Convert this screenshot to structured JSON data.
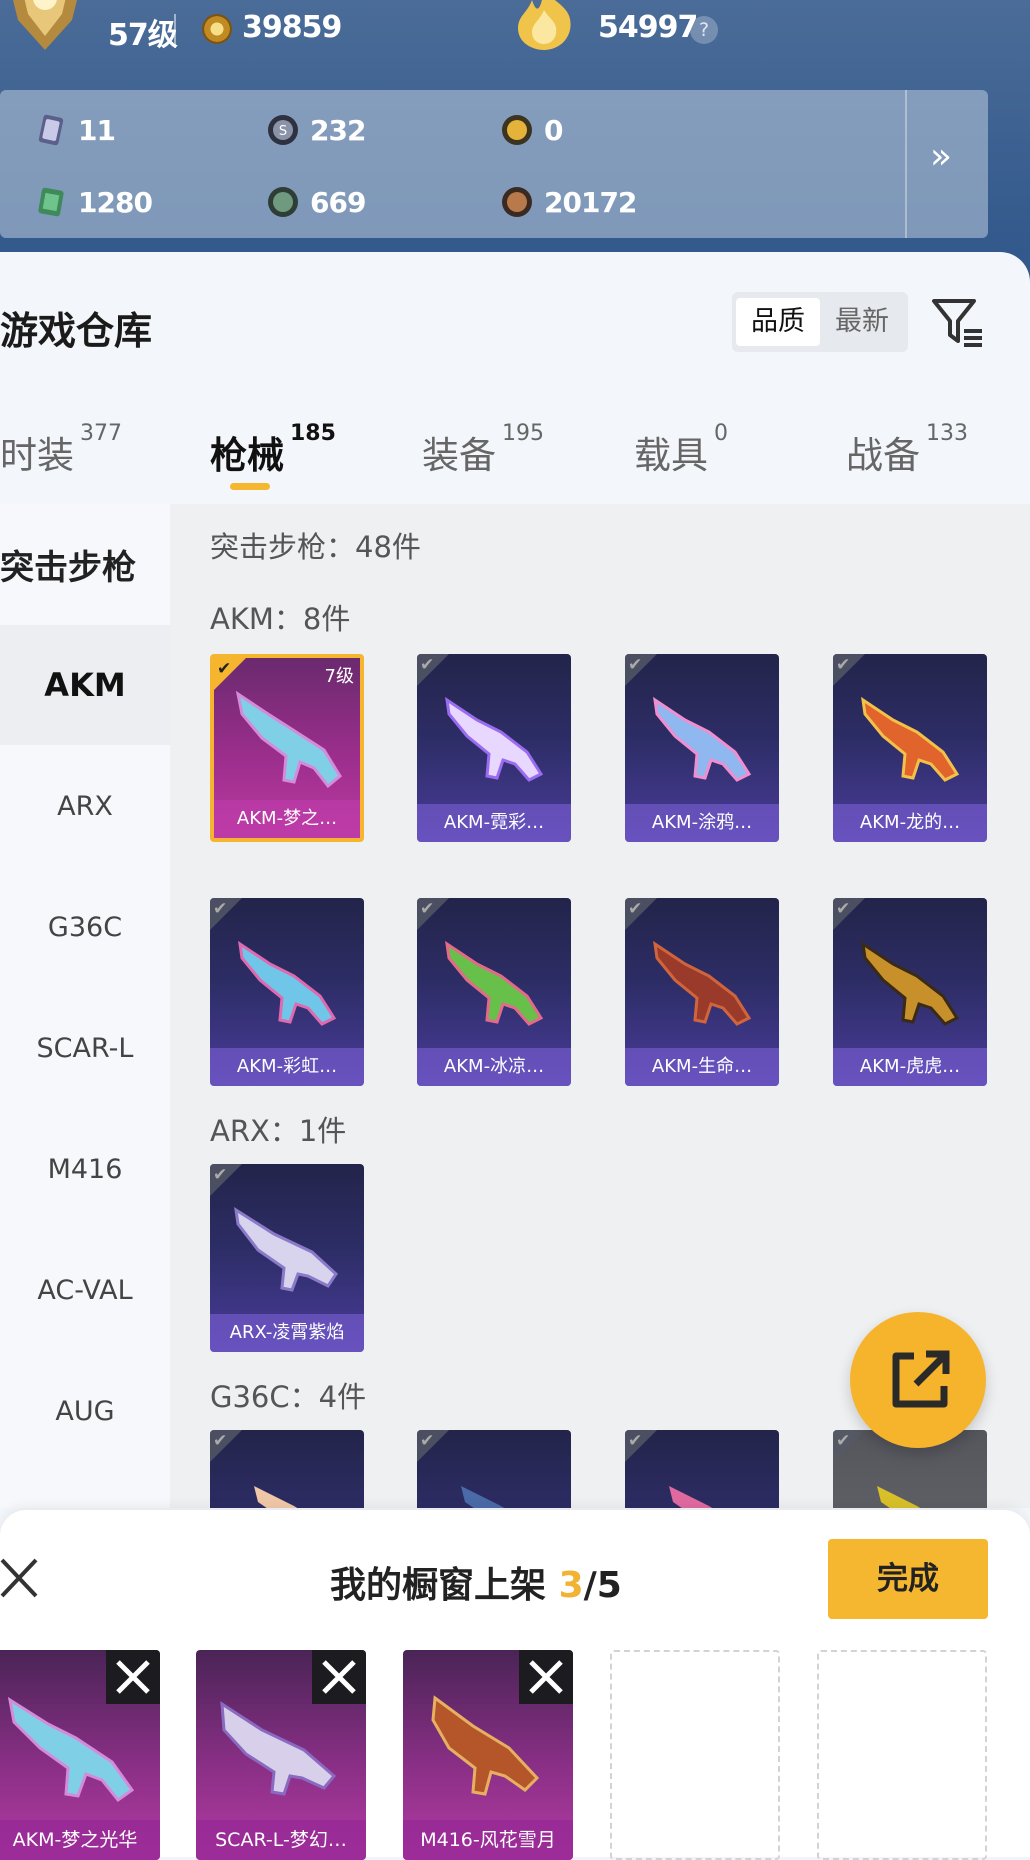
{
  "header": {
    "level": "57级",
    "coins": "39859",
    "heat": "54997",
    "help": "?"
  },
  "currencies": [
    {
      "icon": "card-icon",
      "value": "11"
    },
    {
      "icon": "silver-coin-icon",
      "value": "232"
    },
    {
      "icon": "gold-token-icon",
      "value": "0"
    },
    {
      "icon": "voucher-icon",
      "value": "1280"
    },
    {
      "icon": "green-orb-icon",
      "value": "669"
    },
    {
      "icon": "bronze-orb-icon",
      "value": "20172"
    }
  ],
  "warehouse": {
    "title": "游戏仓库",
    "sort": {
      "active": "品质",
      "other": "最新"
    }
  },
  "tabs": [
    {
      "label": "时装",
      "count": "377"
    },
    {
      "label": "枪械",
      "count": "185"
    },
    {
      "label": "装备",
      "count": "195"
    },
    {
      "label": "载具",
      "count": "0"
    },
    {
      "label": "战备",
      "count": "133"
    }
  ],
  "sidebar": {
    "header": "突击步枪",
    "items": [
      "AKM",
      "ARX",
      "G36C",
      "SCAR-L",
      "M416",
      "AC-VAL",
      "AUG"
    ]
  },
  "content": {
    "total": "突击步枪：48件",
    "groups": [
      {
        "label": "AKM：8件",
        "items": [
          "AKM-梦之…",
          "AKM-霓彩…",
          "AKM-涂鸦…",
          "AKM-龙的…",
          "AKM-彩虹…",
          "AKM-冰凉…",
          "AKM-生命…",
          "AKM-虎虎…"
        ]
      },
      {
        "label": "ARX：1件",
        "items": [
          "ARX-凌霄紫焰"
        ]
      },
      {
        "label": "G36C：4件",
        "items": [
          "",
          "",
          "",
          ""
        ]
      }
    ],
    "selected_level": "7级"
  },
  "shelf": {
    "title": "我的橱窗上架",
    "count": "3",
    "max": "/5",
    "done": "完成",
    "slots": [
      "AKM-梦之光华",
      "SCAR-L-梦幻…",
      "M416-风花雪月"
    ]
  },
  "colors": {
    "accent": "#f5b730",
    "header_bg": "#3a5f90"
  }
}
